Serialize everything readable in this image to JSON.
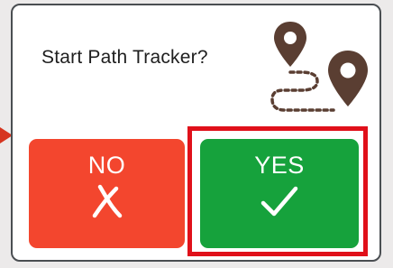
{
  "dialog": {
    "prompt": "Start Path Tracker?",
    "icon": "route-with-pins-icon"
  },
  "buttons": {
    "no_label": "NO",
    "no_icon": "cross-icon",
    "yes_label": "YES",
    "yes_icon": "checkmark-icon"
  },
  "colors": {
    "no_button": "#f3462e",
    "yes_button": "#16a23c",
    "highlight": "#e0101a",
    "pin": "#5a3e32",
    "dialog_border": "#4a4e52"
  }
}
